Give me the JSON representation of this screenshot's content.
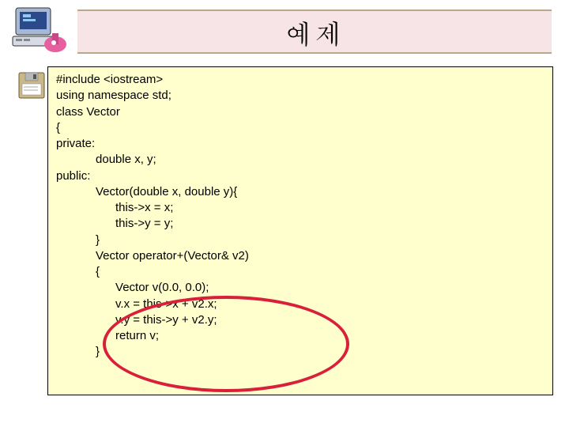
{
  "title": "예제",
  "code": {
    "l01": "#include <iostream>",
    "l02": "using namespace std;",
    "l03": "",
    "l04": "class Vector",
    "l05": "{",
    "l06": "private:",
    "l07": "            double x, y;",
    "l08": "public:",
    "l09": "            Vector(double x, double y){",
    "l10": "                  this->x = x;",
    "l11": "",
    "l12": "",
    "l13": "                  this->y = y;",
    "l14": "            }",
    "l15": "            Vector operator+(Vector& v2)",
    "l16": "            {",
    "l17": "                  Vector v(0.0, 0.0);",
    "l18": "                  v.x = this->x + v2.x;",
    "l19": "                  v.y = this->y + v2.y;",
    "l20": "                  return v;",
    "l21": "            }"
  },
  "icons": {
    "computer": "computer-icon",
    "disk": "floppy-disk-icon"
  }
}
